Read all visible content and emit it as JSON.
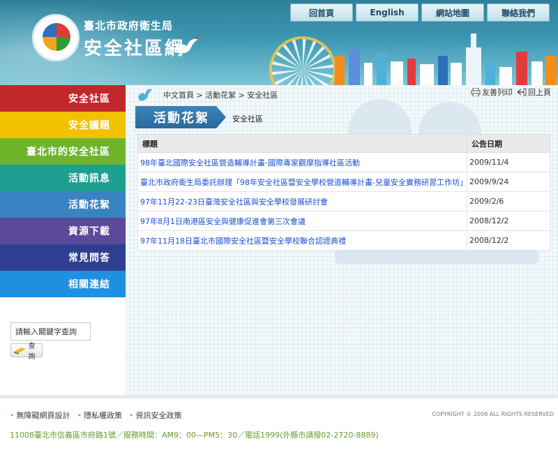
{
  "header": {
    "org_name": "臺北市政府衛生局",
    "site_name": "安全社區網",
    "nav": [
      "回首頁",
      "English",
      "網站地圖",
      "聯絡我們"
    ]
  },
  "sidebar": {
    "items": [
      {
        "label": "安全社區",
        "color": "#c0282a"
      },
      {
        "label": "安全議題",
        "color": "#f2c200"
      },
      {
        "label": "臺北市的安全社區",
        "color": "#6fb52c"
      },
      {
        "label": "活動訊息",
        "color": "#1f9f8f"
      },
      {
        "label": "活動花絮",
        "color": "#3a83c2"
      },
      {
        "label": "資源下載",
        "color": "#5b4a9a"
      },
      {
        "label": "常見問答",
        "color": "#2f3f8f"
      },
      {
        "label": "相關連結",
        "color": "#1f8fe0"
      }
    ],
    "search_value": "請輸入關鍵字查詢",
    "search_button": "查詢"
  },
  "main": {
    "breadcrumb": "中文首頁 > 活動花絮 > 安全社區",
    "print_label": "友善列印",
    "back_label": "回上頁",
    "title": "活動花絮",
    "subtitle": "安全社區",
    "columns": [
      "標題",
      "公告日期"
    ],
    "rows": [
      {
        "title": "98年臺北國際安全社區營造輔導計畫-國際專家觀摩指導社區活動",
        "date": "2009/11/4"
      },
      {
        "title": "臺北市政府衛生局委託辦理「98年安全社區暨安全學校營造輔導計畫-兒童安全實務研習工作坊」",
        "date": "2009/9/24"
      },
      {
        "title": "97年11月22-23日臺灣安全社區與安全學校發展研討會",
        "date": "2009/2/6"
      },
      {
        "title": "97年8月1日南港區安全與健康促進會第三次會議",
        "date": "2008/12/2"
      },
      {
        "title": "97年11月18日臺北市國際安全社區暨安全學校聯合認證典禮",
        "date": "2008/12/2"
      }
    ]
  },
  "footer": {
    "links": [
      "無障礙網頁設計",
      "隱私權政策",
      "資訊安全政策"
    ],
    "copyright": "COPYRIGHT © 2008 ALL RIGHTS RESERVED",
    "address": "11008臺北市信義區市府路1號／服務時間：AM9：00—PM5：30／電話1999(外縣市請撥02-2720-8889)"
  }
}
